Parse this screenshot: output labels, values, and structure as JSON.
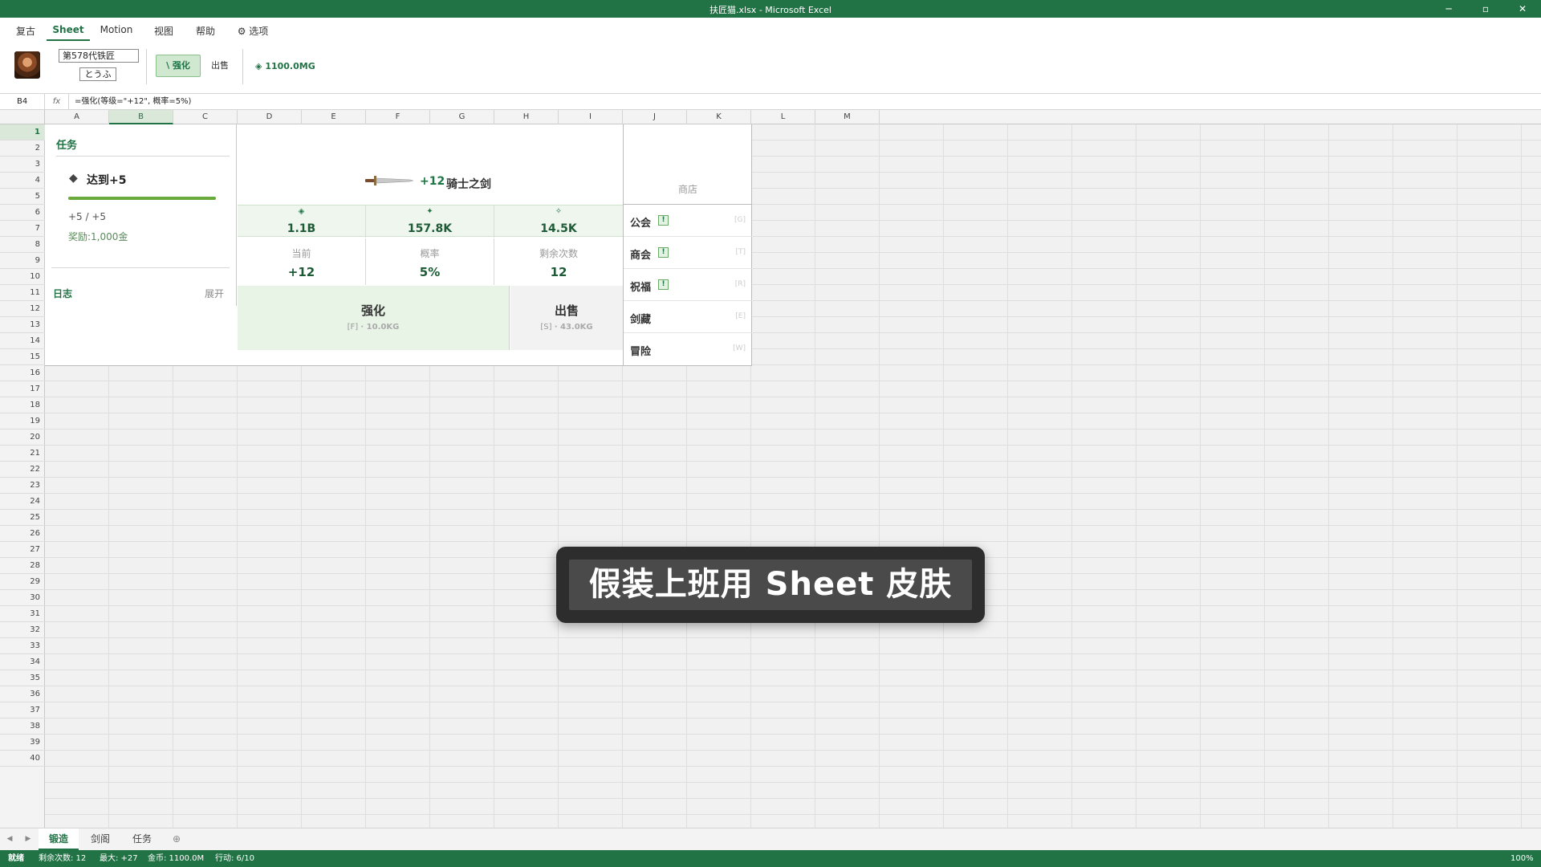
{
  "window": {
    "title": "扶匠猫.xlsx - Microsoft Excel",
    "minimize": "─",
    "maximize": "▫",
    "close": "✕"
  },
  "ribbon_tabs": [
    "复古",
    "Sheet",
    "Motion",
    "视图",
    "帮助",
    "⚙ 选项"
  ],
  "ribbon": {
    "generation": "第578代铁匠",
    "name": "とうふ",
    "enhance_label": "\\ 强化",
    "sell_label": "出售",
    "gold_icon": "◈",
    "gold": "1100.0MG"
  },
  "formula": {
    "cell": "B4",
    "fx": "fx",
    "text": "=强化(等级=\"+12\", 概率=5%)"
  },
  "columns": [
    "A",
    "B",
    "C",
    "D",
    "E",
    "F",
    "G",
    "H",
    "I",
    "J",
    "K",
    "L",
    "M"
  ],
  "rows": [
    "1",
    "2",
    "3",
    "4",
    "5",
    "6",
    "7",
    "8",
    "9",
    "10",
    "11",
    "12",
    "13",
    "14",
    "15",
    "16",
    "17",
    "18",
    "19",
    "20",
    "21",
    "22",
    "23",
    "24",
    "25",
    "26",
    "27",
    "28",
    "29",
    "30",
    "31",
    "32",
    "33",
    "34",
    "35",
    "36",
    "37",
    "38",
    "39",
    "40"
  ],
  "quest": {
    "title": "任务",
    "bullet": "◆",
    "goal": "达到+5",
    "progress": 1.0,
    "count": "+5 / +5",
    "reward": "奖励:1,000金"
  },
  "log": {
    "title": "日志",
    "expand": "展开"
  },
  "weapon": {
    "level": "+12",
    "name": "骑士之剑"
  },
  "shop_title": "商店",
  "stats": [
    {
      "icon": "◈",
      "value": "1.1B"
    },
    {
      "icon": "✦",
      "value": "157.8K"
    },
    {
      "icon": "✧",
      "value": "14.5K"
    }
  ],
  "info": [
    {
      "label": "当前",
      "value": "+12"
    },
    {
      "label": "概率",
      "value": "5%"
    },
    {
      "label": "剩余次数",
      "value": "12"
    }
  ],
  "actions": {
    "enhance": {
      "title": "强化",
      "key": "[F]",
      "cost": "· 10.0KG"
    },
    "sell": {
      "title": "出售",
      "key": "[S]",
      "cost": "· 43.0KG"
    }
  },
  "shop_items": [
    {
      "name": "公会",
      "badge": "!",
      "key": "[G]"
    },
    {
      "name": "商会",
      "badge": "!",
      "key": "[T]"
    },
    {
      "name": "祝福",
      "badge": "!",
      "key": "[R]"
    },
    {
      "name": "剑藏",
      "key": "[E]"
    },
    {
      "name": "冒险",
      "key": "[W]"
    }
  ],
  "toast": "假装上班用 Sheet 皮肤",
  "sheet_tabs": {
    "prev": "◀",
    "next": "▶",
    "tabs": [
      "锻造",
      "剑阁",
      "任务"
    ],
    "add": "⊕"
  },
  "status": {
    "ready": "就绪",
    "remaining": "剩余次数: 12",
    "max": "最大: +27",
    "gold": "金币: 1100.0M",
    "action": "行动: 6/10",
    "zoom": "100%"
  }
}
